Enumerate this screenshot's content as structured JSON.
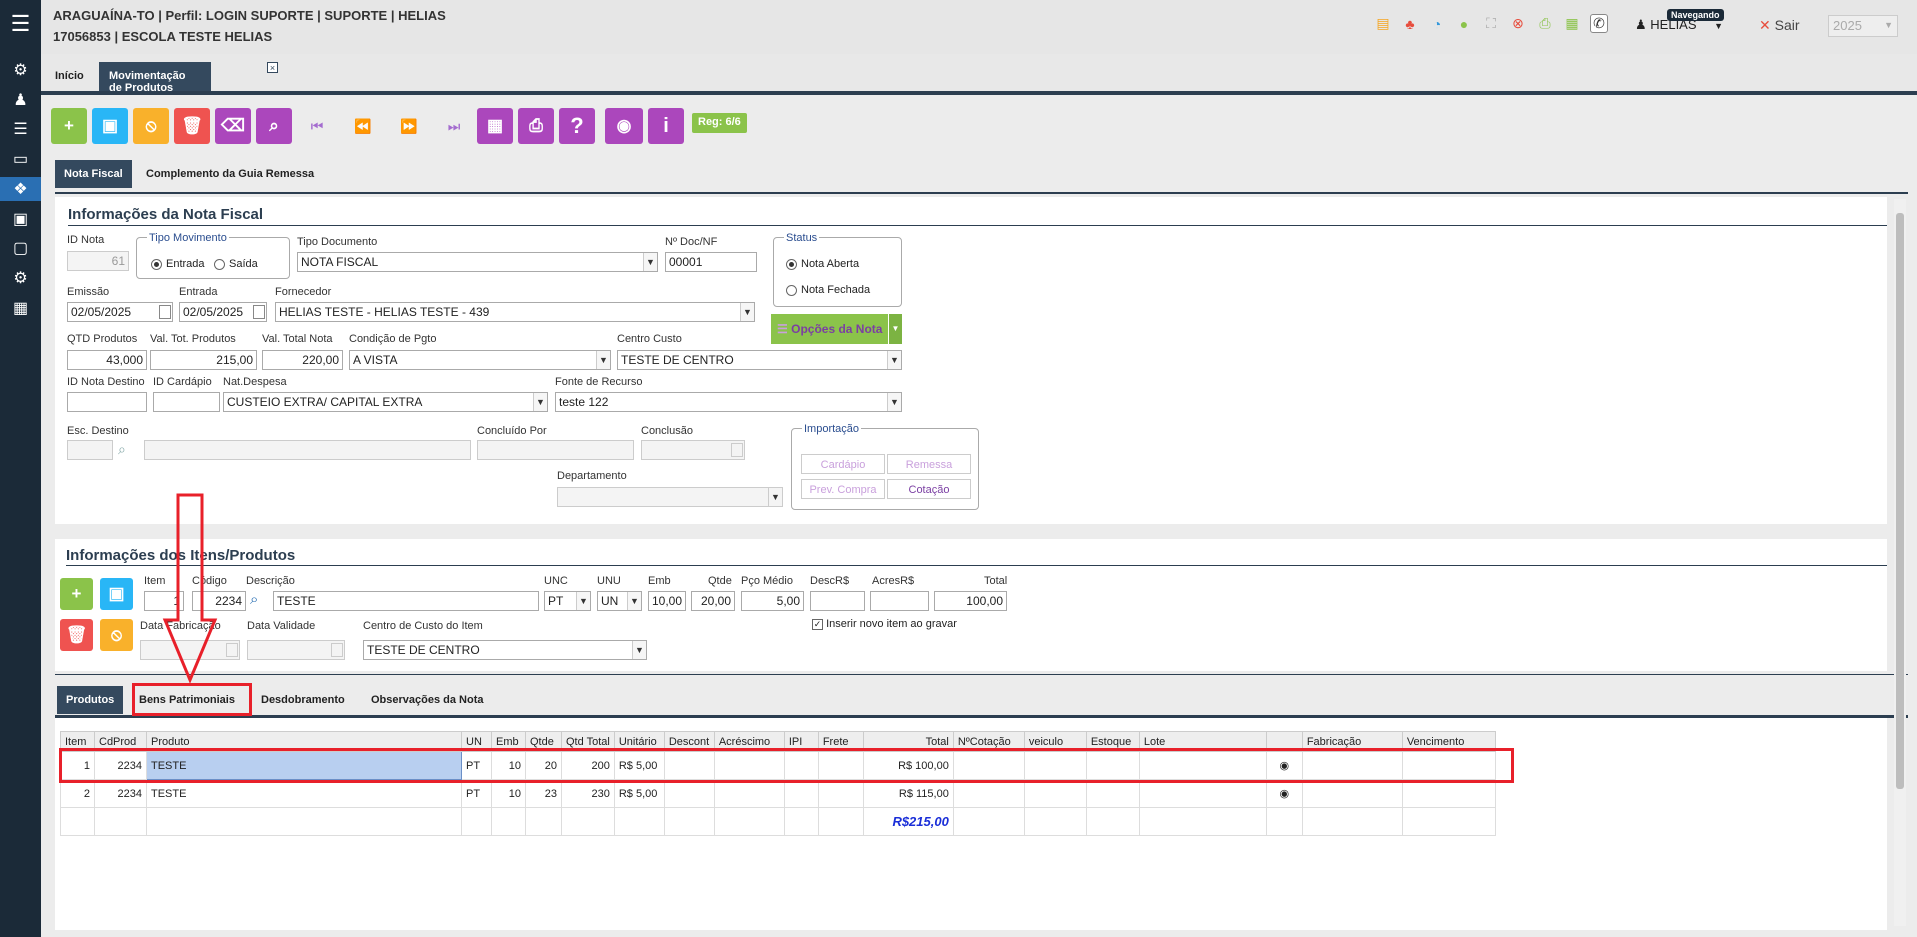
{
  "header": {
    "line1": "ARAGUAÍNA-TO | Perfil: LOGIN SUPORTE | SUPORTE | HELIAS",
    "line2": "17056853 | ESCOLA TESTE HELIAS",
    "user": "HELIAS",
    "user_badge": "Navegando",
    "logout": "Sair",
    "year": "2025"
  },
  "tabs": {
    "home": "Início",
    "active": "Movimentação de Produtos"
  },
  "toolbar": {
    "reg": "Reg: 6/6"
  },
  "nf_tabs": {
    "nota": "Nota Fiscal",
    "complemento": "Complemento da Guia Remessa"
  },
  "nota": {
    "title": "Informações da Nota Fiscal",
    "id_nota_label": "ID Nota",
    "id_nota": "61",
    "tipo_mov_label": "Tipo Movimento",
    "entrada": "Entrada",
    "saida": "Saída",
    "tipo_doc_label": "Tipo Documento",
    "tipo_doc": "NOTA FISCAL",
    "ndoc_label": "Nº Doc/NF",
    "ndoc": "00001",
    "status_label": "Status",
    "aberta": "Nota Aberta",
    "fechada": "Nota Fechada",
    "emissao_label": "Emissão",
    "emissao": "02/05/2025",
    "entrada_label": "Entrada",
    "entrada_data": "02/05/2025",
    "fornecedor_label": "Fornecedor",
    "fornecedor": "HELIAS TESTE - HELIAS TESTE - 439",
    "opcoes": "Opções da Nota",
    "qtd_label": "QTD Produtos",
    "qtd": "43,000",
    "valtot_label": "Val. Tot. Produtos",
    "valtot": "215,00",
    "valnota_label": "Val. Total Nota",
    "valnota": "220,00",
    "cond_label": "Condição de Pgto",
    "cond": "A  VISTA",
    "centro_label": "Centro Custo",
    "centro": "TESTE DE CENTRO",
    "idnd_label": "ID Nota Destino",
    "idcard_label": "ID Cardápio",
    "natdesp_label": "Nat.Despesa",
    "natdesp": "CUSTEIO EXTRA/ CAPITAL EXTRA",
    "fonte_label": "Fonte de Recurso",
    "fonte": "teste 122",
    "escdest_label": "Esc. Destino",
    "concpor_label": "Concluído Por",
    "conclusao_label": "Conclusão",
    "depto_label": "Departamento",
    "importacao_label": "Importação",
    "cardapio": "Cardápio",
    "remessa": "Remessa",
    "prevcompra": "Prev. Compra",
    "cotacao": "Cotação"
  },
  "itens": {
    "title": "Informações dos Itens/Produtos",
    "item_label": "Item",
    "item": "1",
    "codigo_label": "Código",
    "codigo": "2234",
    "desc_label": "Descrição",
    "desc": "TESTE",
    "unc_label": "UNC",
    "unc": "PT",
    "unu_label": "UNU",
    "unu": "UN",
    "emb_label": "Emb",
    "emb": "10,00",
    "qtde_label": "Qtde",
    "qtde": "20,00",
    "pco_label": "Pço Médio",
    "pco": "5,00",
    "descr_label": "DescR$",
    "acres_label": "AcresR$",
    "total_label": "Total",
    "total": "100,00",
    "fab_label": "Data Fabricação",
    "val_label": "Data Validade",
    "cc_label": "Centro de Custo do Item",
    "cc": "TESTE DE CENTRO",
    "inserir": "Inserir novo item ao gravar"
  },
  "subtabs": {
    "produtos": "Produtos",
    "bens": "Bens Patrimoniais",
    "desdob": "Desdobramento",
    "obs": "Observações da Nota"
  },
  "grid": {
    "headers": [
      "Item",
      "CdProd",
      "Produto",
      "UN",
      "Emb",
      "Qtde",
      "Qtd Total",
      "Unitário",
      "Descont",
      "Acréscimo",
      "IPI",
      "Frete",
      "Total",
      "NºCotação",
      "veiculo",
      "Estoque",
      "Lote",
      "",
      "Fabricação",
      "Vencimento"
    ],
    "rows": [
      [
        "1",
        "2234",
        "TESTE",
        "PT",
        "10",
        "20",
        "200",
        "R$ 5,00",
        "",
        "",
        "",
        "",
        "R$ 100,00",
        "",
        "",
        "",
        "",
        "",
        "",
        ""
      ],
      [
        "2",
        "2234",
        "TESTE",
        "PT",
        "10",
        "23",
        "230",
        "R$ 5,00",
        "",
        "",
        "",
        "",
        "R$ 115,00",
        "",
        "",
        "",
        "",
        "",
        "",
        ""
      ]
    ],
    "total": "R$215,00"
  }
}
